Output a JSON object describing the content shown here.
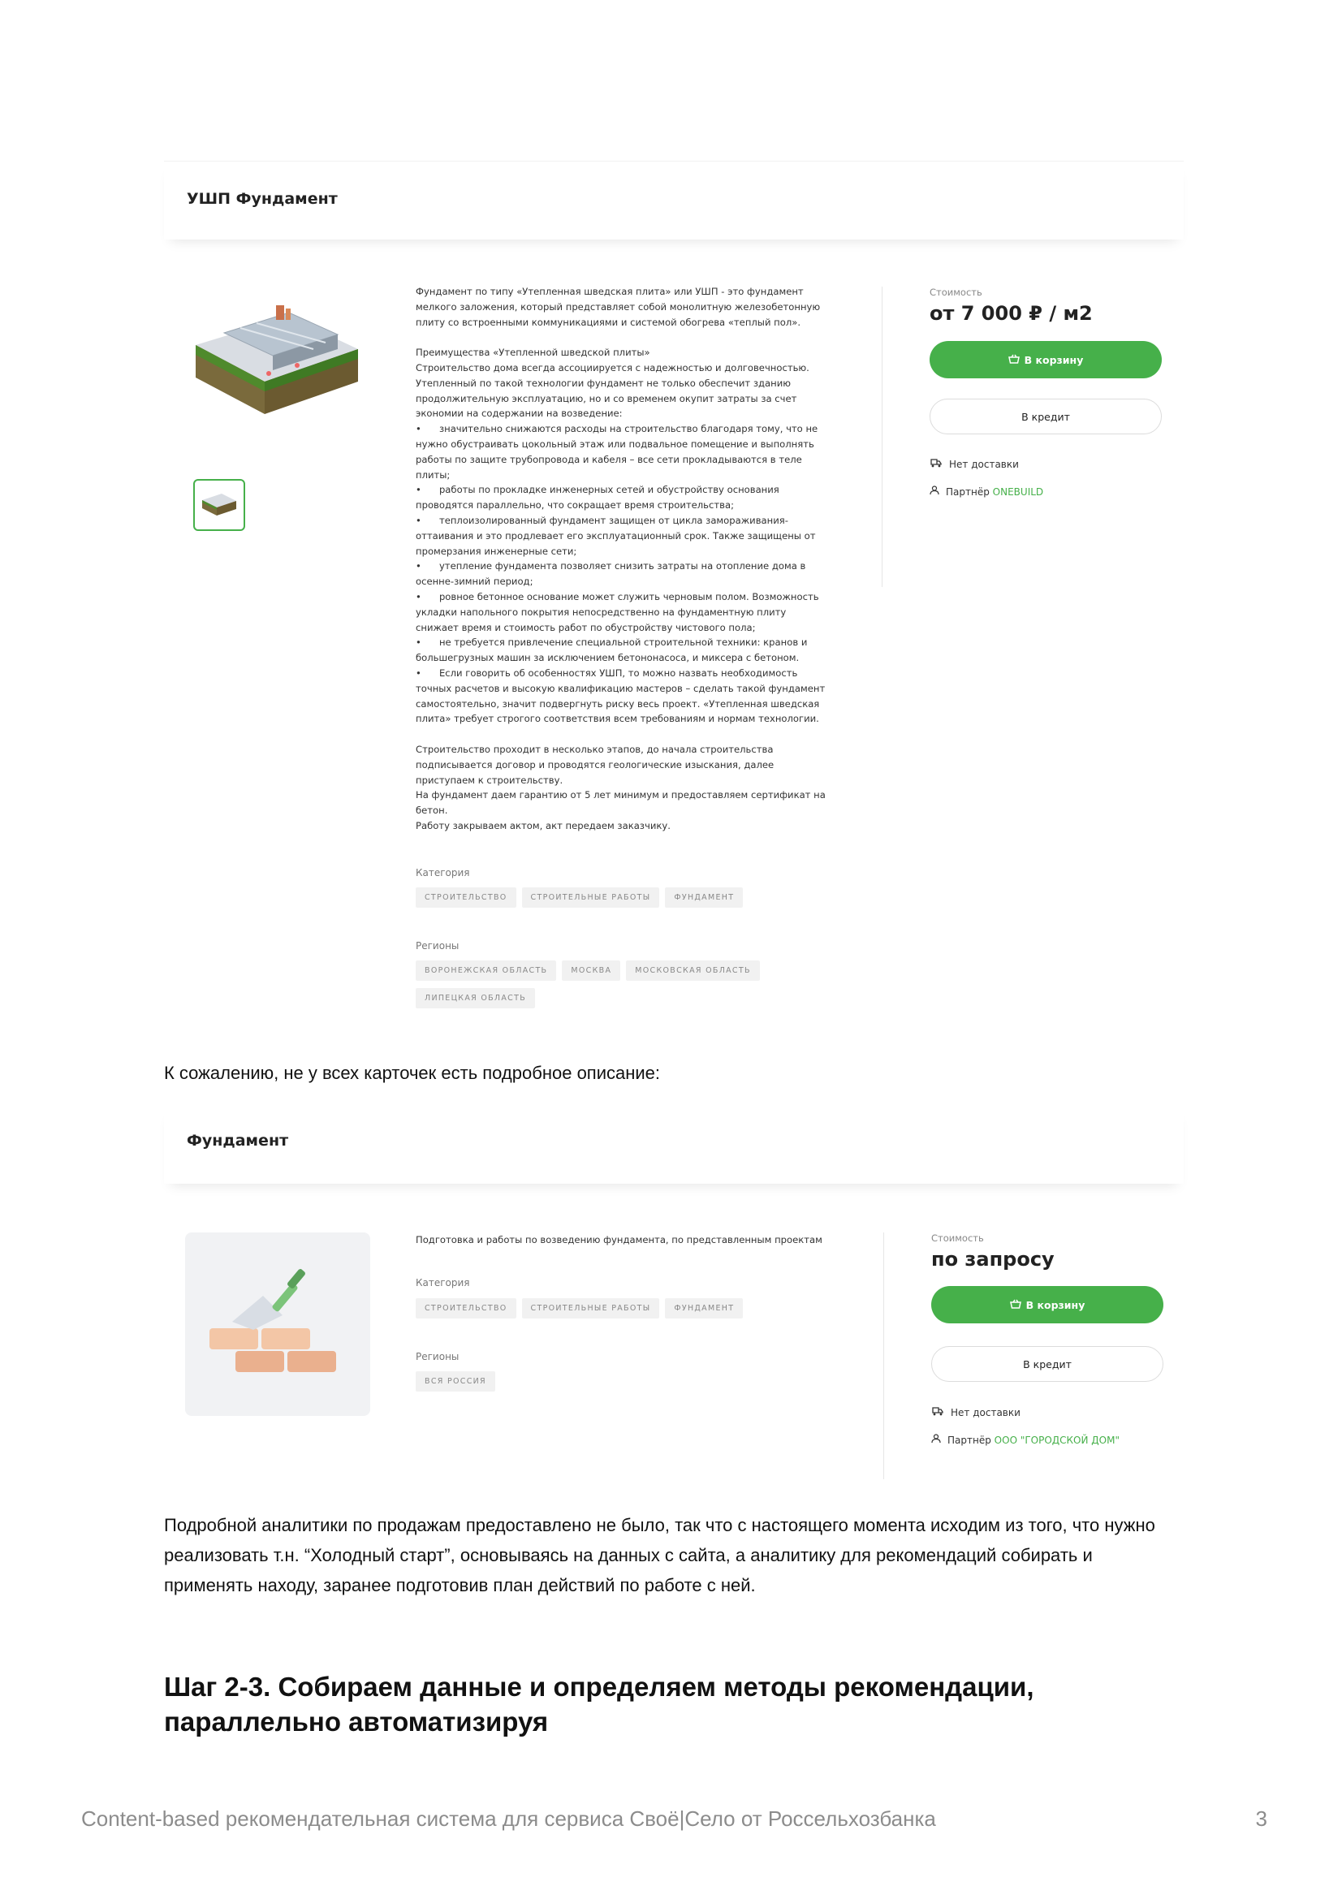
{
  "card1": {
    "title": "УШП Фундамент",
    "description": "Фундамент по типу «Утепленная шведская плита» или УШП - это фундамент\nмелкого заложения, который представляет собой монолитную железобетонную\nплиту со встроенными коммуникациями и системой обогрева «теплый пол».\n\nПреимущества «Утепленной шведской плиты»\nСтроительство дома всегда ассоциируется с надежностью и долговечностью.\nУтепленный по такой технологии фундамент не только обеспечит зданию\nпродолжительную эксплуатацию, но и со временем окупит затраты за счет\nэкономии на содержании на возведение:\n•      значительно снижаются расходы на строительство благодаря тому, что не\nнужно обустраивать цокольный этаж или подвальное помещение и выполнять\nработы по защите трубопровода и кабеля – все сети прокладываются в теле\nплиты;\n•      работы по прокладке инженерных сетей и обустройству основания\nпроводятся параллельно, что сокращает время строительства;\n•      теплоизолированный фундамент защищен от цикла замораживания-\nоттаивания и это продлевает его эксплуатационный срок. Также защищены от\nпромерзания инженерные сети;\n•      утепление фундамента позволяет снизить затраты на отопление дома в\nосенне-зимний период;\n•      ровное бетонное основание может служить черновым полом. Возможность\nукладки напольного покрытия непосредственно на фундаментную плиту\nснижает время и стоимость работ по обустройству чистового пола;\n•      не требуется привлечение специальной строительной техники: кранов и\nбольшегрузных машин за исключением бетононасоса, и миксера с бетоном.\n•      Если говорить об особенностях УШП, то можно назвать необходимость\nточных расчетов и высокую квалификацию мастеров – сделать такой фундамент\nсамостоятельно, значит подвергнуть риску весь проект. «Утепленная шведская\nплита» требует строгого соответствия всем требованиям и нормам технологии.\n\nСтроительство проходит в несколько этапов, до начала строительства\nподписывается договор и проводятся геологические изыскания, далее\nприступаем к строительству.\nНа фундамент даем гарантию от 5 лет минимум и предоставляем сертификат на\nбетон.\nРаботу закрываем актом, акт передаем заказчику.",
    "category_label": "Категория",
    "categories": [
      "строительство",
      "строительные работы",
      "фундамент"
    ],
    "regions_label": "Регионы",
    "regions": [
      "воронежская область",
      "москва",
      "московская область",
      "липецкая область"
    ],
    "price_label": "Стоимость",
    "price": "от 7 000 ₽ / м2",
    "cart_button": "В корзину",
    "credit_button": "В кредит",
    "delivery": "Нет доставки",
    "partner_prefix": "Партнёр",
    "partner_name": "ONEBUILD"
  },
  "para1": "К сожалению, не у всех карточек есть подробное описание:",
  "card2": {
    "title": "Фундамент",
    "description": "Подготовка и работы по возведению фундамента, по представленным проектам",
    "category_label": "Категория",
    "categories": [
      "строительство",
      "строительные работы",
      "фундамент"
    ],
    "regions_label": "Регионы",
    "regions": [
      "вся россия"
    ],
    "price_label": "Стоимость",
    "price": "по запросу",
    "cart_button": "В корзину",
    "credit_button": "В кредит",
    "delivery": "Нет доставки",
    "partner_prefix": "Партнёр",
    "partner_name": "ООО \"ГОРОДСКОЙ ДОМ\""
  },
  "para2": "Подробной аналитики по продажам предоставлено не было, так что с настоящего момента исходим из того, что нужно реализовать т.н. “Холодный старт”, основываясь на данных с сайта, а аналитику для рекомендаций собирать и применять находу, заранее подготовив план действий по работе с ней.",
  "heading": "Шаг 2-3. Собираем данные и определяем методы рекомендации, параллельно автоматизируя",
  "footer": {
    "text": "Content-based рекомендательная система для сервиса Своё|Село от Россельхозбанка",
    "page": "3"
  },
  "colors": {
    "accent": "#46b04a",
    "text": "#111111",
    "muted": "#8c8c8c"
  }
}
